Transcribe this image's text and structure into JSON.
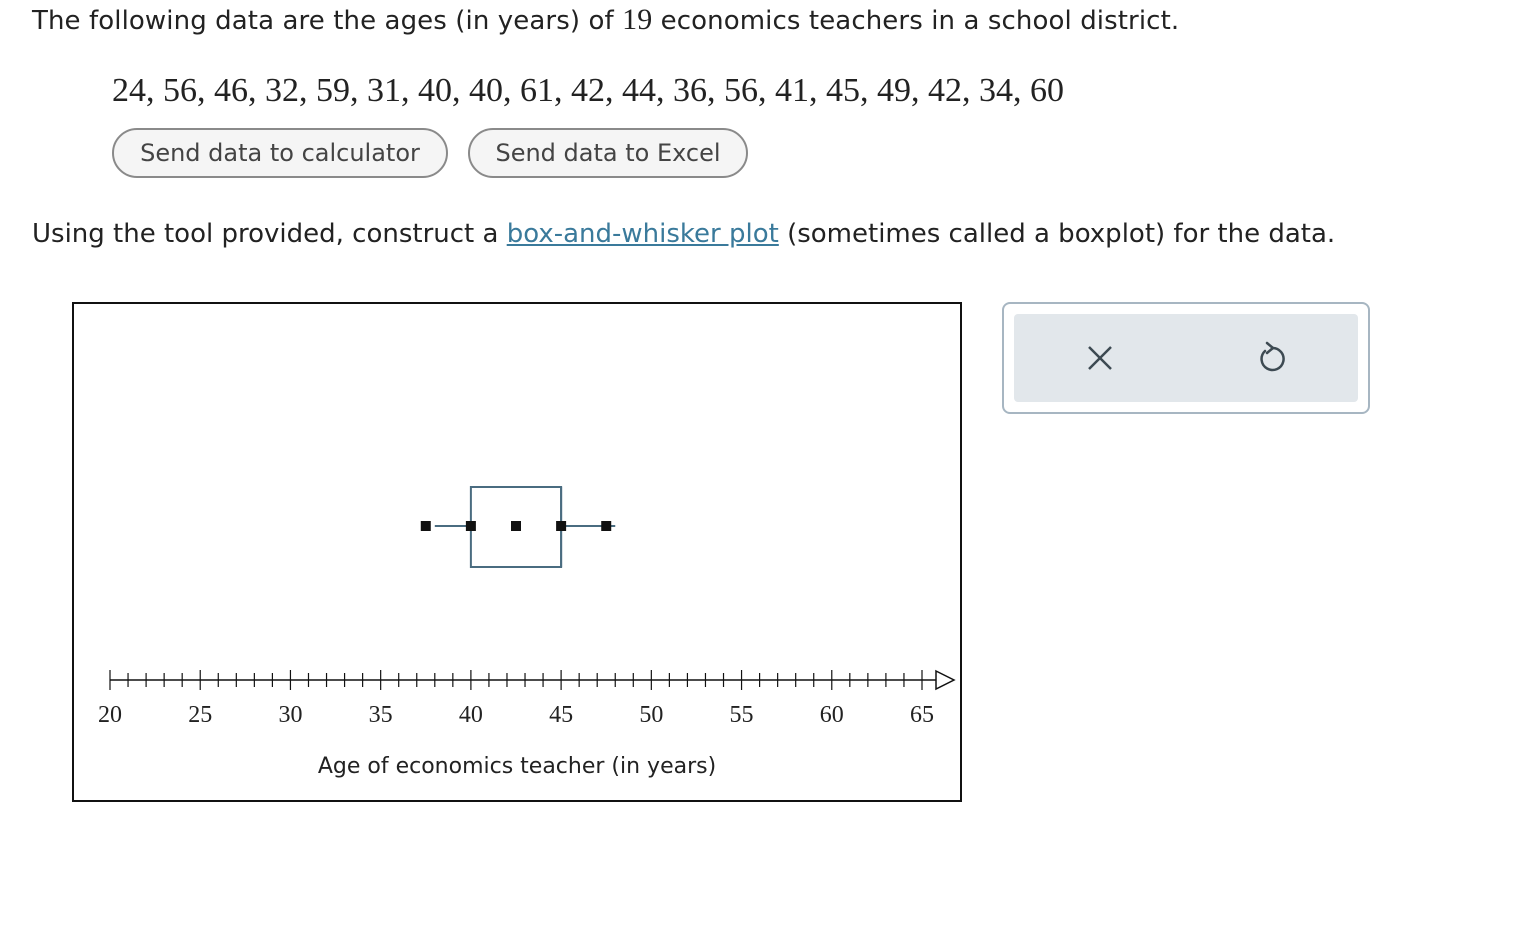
{
  "question": {
    "intro_before": "The following data are the ages (in years) of",
    "count": "19",
    "intro_after": "economics teachers in a school district.",
    "data_values": "24, 56, 46, 32, 59, 31, 40, 40, 61, 42, 44, 36, 56, 41, 45, 49, 42, 34, 60",
    "instruction_before": "Using the tool provided, construct a",
    "link_text": "box-and-whisker plot",
    "instruction_after": "(sometimes called a boxplot) for the data."
  },
  "buttons": {
    "calculator": "Send data to calculator",
    "excel": "Send data to Excel"
  },
  "tools": {
    "clear_icon": "close-icon",
    "undo_icon": "undo-icon"
  },
  "chart_data": {
    "type": "boxplot",
    "xlabel": "Age of economics teacher (in years)",
    "xlim": [
      20,
      65
    ],
    "major_ticks": [
      20,
      25,
      30,
      35,
      40,
      45,
      50,
      55,
      60,
      65
    ],
    "minor_tick_step": 1,
    "boxplot": {
      "min": 38,
      "q1": 40,
      "median": 45,
      "q3": 45,
      "max": 48
    },
    "plotted_points": [
      37.5,
      40,
      42.5,
      45,
      47.5
    ],
    "colors": {
      "box": "#4a6c80",
      "marker": "#111111",
      "axis": "#111111"
    }
  }
}
